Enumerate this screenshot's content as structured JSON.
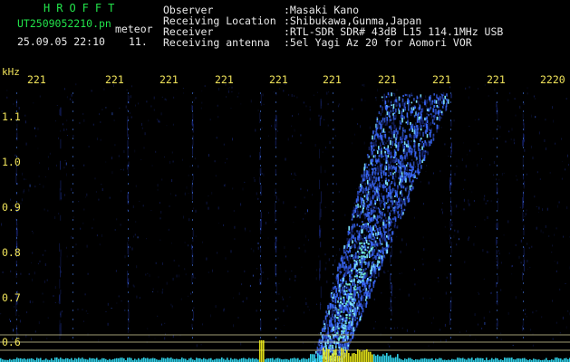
{
  "header": {
    "brand": "HROFFT",
    "filename": "UT2509052210.pn",
    "mode": "meteor",
    "datetime": "25.09.05 22:10",
    "count": "11.",
    "info": [
      {
        "label": "Observer",
        "value": ":Masaki Kano"
      },
      {
        "label": "Receiving Location",
        "value": ":Shibukawa,Gunma,Japan"
      },
      {
        "label": "Receiver",
        "value": ":RTL-SDR SDR# 43dB L15 114.1MHz USB"
      },
      {
        "label": "Receiving antenna",
        "value": ":5el Yagi Az 20 for Aomori VOR"
      }
    ]
  },
  "spectrogram": {
    "unit_label": "kHz",
    "time_ticks": [
      "221",
      "221",
      "221",
      "221",
      "221",
      "221",
      "221",
      "221",
      "221",
      "2220"
    ],
    "freq_ticks": [
      "1.1",
      "1.0",
      "0.9",
      "0.8",
      "0.7",
      "0.6"
    ],
    "colors": {
      "background": "#000000",
      "axis_labels": "#f0e35a",
      "tick_marks": "#4f86ff",
      "signal_low": "#1d2f8f",
      "signal_mid": "#3b6bff",
      "signal_high": "#7fe7ff",
      "spectrum_yellow": "#f4f21a",
      "spectrum_cyan": "#35e6ff",
      "guide_lines": "#d6d29a"
    }
  }
}
